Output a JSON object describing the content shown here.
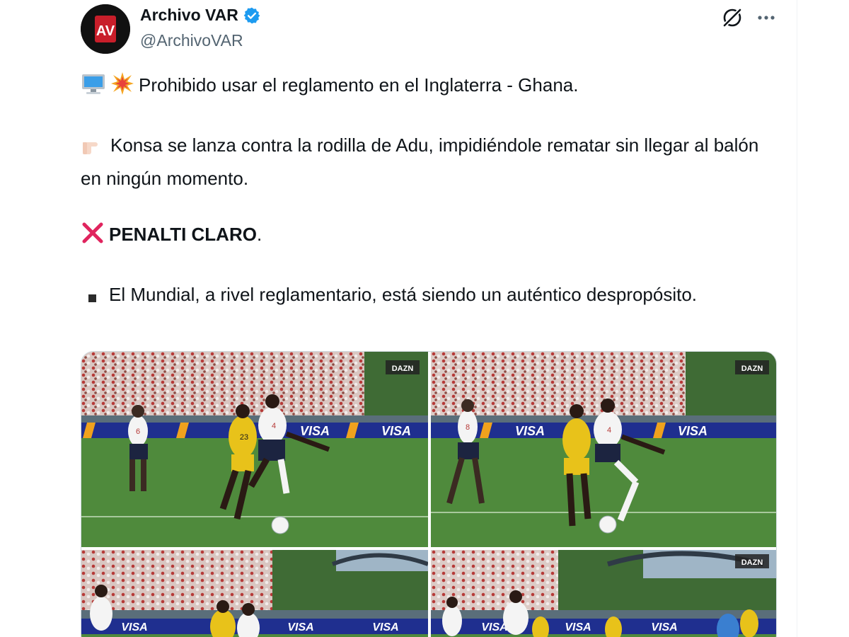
{
  "author": {
    "display_name": "Archivo VAR",
    "handle": "@ArchivoVAR",
    "avatar_text": "AV",
    "verified": true
  },
  "actions": {
    "grok_icon": "grok-icon",
    "more_icon": "more-icon"
  },
  "tweet": {
    "line1": "Prohibido usar el reglamento en el Inglaterra - Ghana.",
    "line2": "Konsa se lanza contra la rodilla de Adu, impidiéndole rematar sin llegar al balón en ningún momento.",
    "line3_bold": "PENALTI CLARO",
    "line3_tail": ".",
    "line4": "El Mundial, a rivel reglamentario, está siendo un auténtico despropósito."
  },
  "media": {
    "board_text": "VISA",
    "broadcaster": "DAZN",
    "shirt_numbers": [
      "6",
      "23",
      "4",
      "8",
      "4"
    ]
  },
  "colors": {
    "accent": "#1d9bf0",
    "text": "#0f1419",
    "secondary": "#536471",
    "pitch": "#4f8a3c",
    "board": "#1f2f8f",
    "ghana_yellow": "#e8c21a",
    "red_x": "#e0245e"
  }
}
